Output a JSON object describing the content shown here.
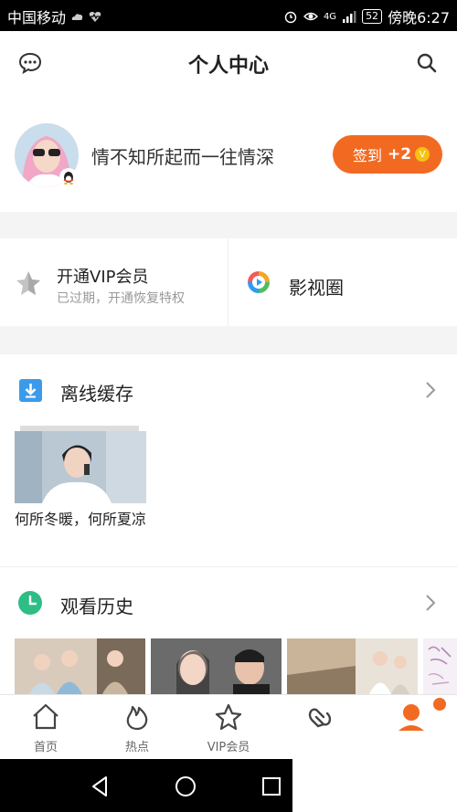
{
  "status_bar": {
    "carrier": "中国移动",
    "network": "4G",
    "battery": "52",
    "time": "傍晚6:27"
  },
  "header": {
    "title": "个人中心",
    "left_icon": "message-icon",
    "right_icon": "search-icon"
  },
  "profile": {
    "username": "情不知所起而一往情深",
    "checkin_label": "签到",
    "checkin_bonus": "+2",
    "coin_symbol": "V"
  },
  "vip": {
    "title": "开通VIP会员",
    "subtitle": "已过期，开通恢复特权",
    "circle_title": "影视圈"
  },
  "offline_cache": {
    "title": "离线缓存",
    "item_caption": "何所冬暖，何所夏凉"
  },
  "history": {
    "title": "观看历史"
  },
  "tabbar": {
    "tabs": [
      {
        "label": "首页",
        "icon": "home-icon"
      },
      {
        "label": "热点",
        "icon": "flame-icon"
      },
      {
        "label": "VIP会员",
        "icon": "vip-star-icon"
      },
      {
        "label": "",
        "icon": "heart-circle-icon"
      },
      {
        "label": "",
        "icon": "profile-icon"
      }
    ],
    "accent": "#f26a22"
  },
  "colors": {
    "accent": "#f26a22",
    "cache_icon": "#3b9bea",
    "history_icon": "#2ebd85"
  }
}
